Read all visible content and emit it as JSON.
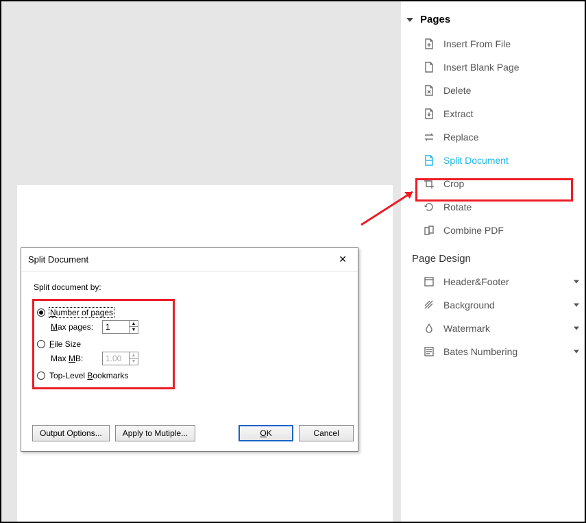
{
  "sidebar": {
    "section_pages": "Pages",
    "section_pagedesign": "Page Design",
    "pages_items": [
      {
        "label": "Insert From File"
      },
      {
        "label": "Insert Blank Page"
      },
      {
        "label": "Delete"
      },
      {
        "label": "Extract"
      },
      {
        "label": "Replace"
      },
      {
        "label": "Split Document"
      },
      {
        "label": "Crop"
      },
      {
        "label": "Rotate"
      },
      {
        "label": "Combine PDF"
      }
    ],
    "design_items": [
      {
        "label": "Header&Footer"
      },
      {
        "label": "Background"
      },
      {
        "label": "Watermark"
      },
      {
        "label": "Bates Numbering"
      }
    ]
  },
  "dialog": {
    "title": "Split Document",
    "prompt": "Split document by:",
    "opt_pages": "Number of pages",
    "opt_pages_sub": "Max pages:",
    "opt_pages_val": "1",
    "opt_size": "File Size",
    "opt_size_sub": "Max MB:",
    "opt_size_val": "1.00",
    "opt_bookmarks": "Top-Level Bookmarks",
    "btn_output": "Output Options...",
    "btn_apply": "Apply to Mutiple...",
    "btn_ok": "OK",
    "btn_cancel": "Cancel"
  }
}
